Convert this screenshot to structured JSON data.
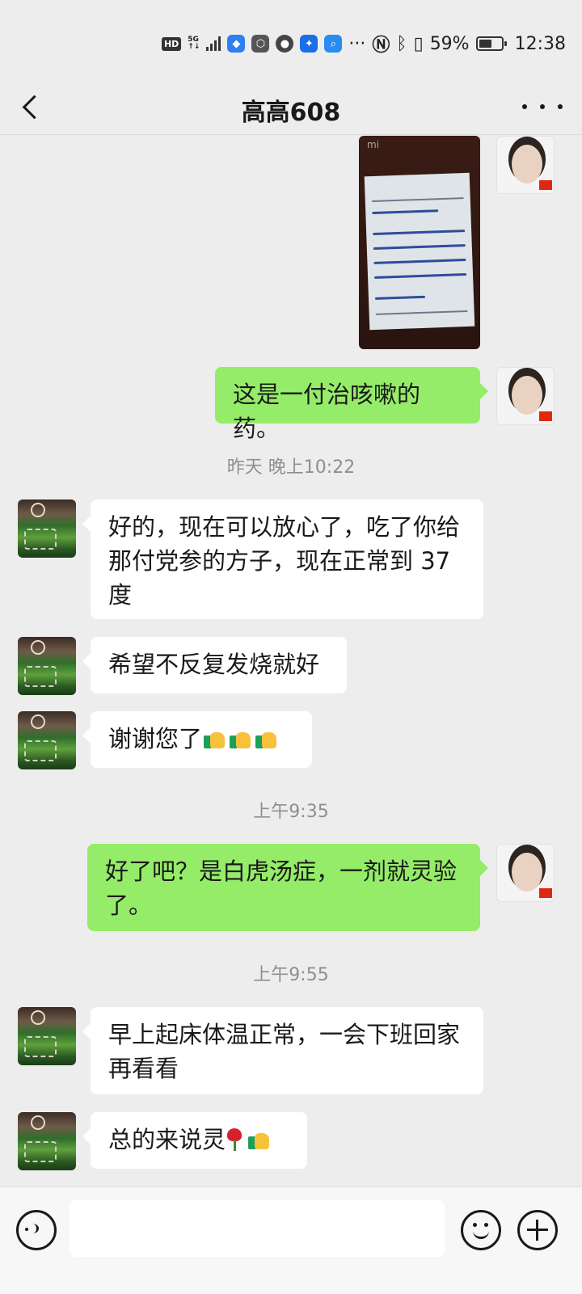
{
  "status_bar": {
    "hd": "HD",
    "network": "5G",
    "battery_percent": "59%",
    "battery_level": 0.59,
    "time": "12:38",
    "more": "···"
  },
  "header": {
    "title": "高高608"
  },
  "messages": [
    {
      "from": "me",
      "type": "image"
    },
    {
      "from": "me",
      "type": "text",
      "text": "这是一付治咳嗽的药。"
    },
    {
      "type": "time",
      "text": "昨天 晚上10:22"
    },
    {
      "from": "friend",
      "type": "text",
      "text": "好的，现在可以放心了，吃了你给那付党参的方子，现在正常到 37 度"
    },
    {
      "from": "friend",
      "type": "text",
      "text": "希望不反复发烧就好"
    },
    {
      "from": "friend",
      "type": "text",
      "text": "谢谢您了",
      "emoji": [
        "thumbs-up",
        "thumbs-up",
        "thumbs-up"
      ]
    },
    {
      "type": "time",
      "text": "上午9:35"
    },
    {
      "from": "me",
      "type": "text",
      "text": "好了吧？是白虎汤症，一剂就灵验了。"
    },
    {
      "type": "time",
      "text": "上午9:55"
    },
    {
      "from": "friend",
      "type": "text",
      "text": "早上起床体温正常，一会下班回家再看看"
    },
    {
      "from": "friend",
      "type": "text",
      "text": "总的来说灵",
      "emoji": [
        "rose",
        "thumbs-up"
      ]
    }
  ],
  "colors": {
    "background": "#ededed",
    "outgoing_bubble": "#95ec69",
    "incoming_bubble": "#ffffff",
    "timestamp": "#8f8f8f"
  }
}
